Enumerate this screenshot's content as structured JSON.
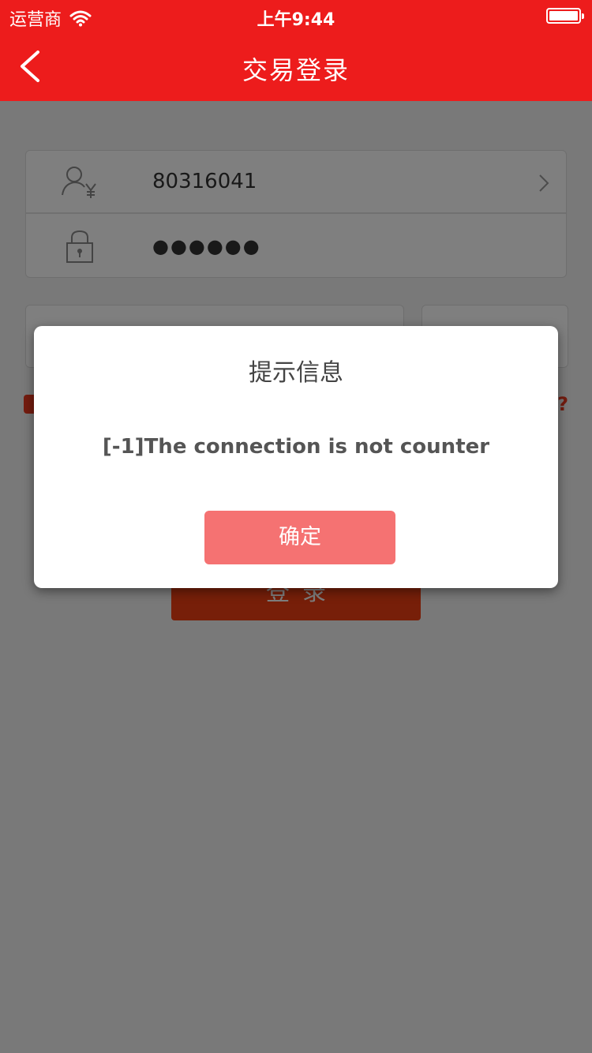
{
  "status_bar": {
    "carrier": "运营商",
    "time": "上午9:44"
  },
  "nav": {
    "title": "交易登录"
  },
  "form": {
    "account_value": "80316041",
    "password_value": "●●●●●●"
  },
  "login_button": {
    "label": "登录"
  },
  "dialog": {
    "title": "提示信息",
    "message": "[-1]The connection is not counter",
    "confirm_label": "确定"
  },
  "colors": {
    "brand_red": "#ed1c1c",
    "confirm_pink": "#f57272",
    "overlay": "rgba(0,0,0,0.5)"
  },
  "icons": [
    "wifi-icon",
    "battery-icon",
    "back-icon",
    "user-yuan-icon",
    "lock-icon",
    "chevron-right-icon",
    "help-icon"
  ]
}
